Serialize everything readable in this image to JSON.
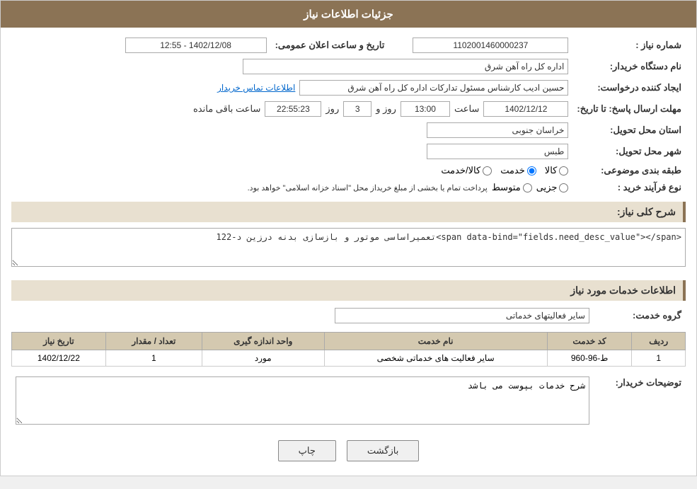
{
  "header": {
    "title": "جزئیات اطلاعات نیاز"
  },
  "fields": {
    "need_number_label": "شماره نیاز :",
    "need_number_value": "1102001460000237",
    "buyer_org_label": "نام دستگاه خریدار:",
    "buyer_org_value": "اداره کل راه آهن شرق",
    "creator_label": "ایجاد کننده درخواست:",
    "creator_value": "حسین ادیب کارشناس مسئول تدارکات اداره کل راه آهن شرق",
    "contact_link": "اطلاعات تماس خریدار",
    "deadline_label": "مهلت ارسال پاسخ: تا تاریخ:",
    "announce_date_label": "تاریخ و ساعت اعلان عمومی:",
    "announce_date_value": "1402/12/08 - 12:55",
    "deadline_date": "1402/12/12",
    "deadline_time": "13:00",
    "remaining_days": "3",
    "remaining_time": "22:55:23",
    "remaining_label": "ساعت باقی مانده",
    "days_label": "روز و",
    "province_label": "استان محل تحویل:",
    "province_value": "خراسان جنوبی",
    "city_label": "شهر محل تحویل:",
    "city_value": "طبس",
    "category_label": "طبقه بندی موضوعی:",
    "category_options": [
      "کالا",
      "خدمت",
      "کالا/خدمت"
    ],
    "category_selected": "خدمت",
    "purchase_type_label": "نوع فرآیند خرید :",
    "purchase_options": [
      "جزیی",
      "متوسط"
    ],
    "purchase_note": "پرداخت تمام یا بخشی از مبلغ خریداز محل \"اسناد خزانه اسلامی\" خواهد بود.",
    "need_desc_label": "شرح کلی نیاز:",
    "need_desc_value": "تعمیراساسی موتور و بازسازی بدنه درزین د-122",
    "services_section_label": "اطلاعات خدمات مورد نیاز",
    "service_group_label": "گروه خدمت:",
    "service_group_value": "سایر فعالیتهای خدماتی",
    "table": {
      "columns": [
        "ردیف",
        "کد خدمت",
        "نام خدمت",
        "واحد اندازه گیری",
        "تعداد / مقدار",
        "تاریخ نیاز"
      ],
      "rows": [
        {
          "row_num": "1",
          "service_code": "ط-96-960",
          "service_name": "سایر فعالیت های خدماتی شخصی",
          "unit": "مورد",
          "quantity": "1",
          "need_date": "1402/12/22"
        }
      ]
    },
    "buyer_desc_label": "توضیحات خریدار:",
    "buyer_desc_value": "شرح خدمات بپوست می باشد"
  },
  "buttons": {
    "print_label": "چاپ",
    "back_label": "بازگشت"
  }
}
